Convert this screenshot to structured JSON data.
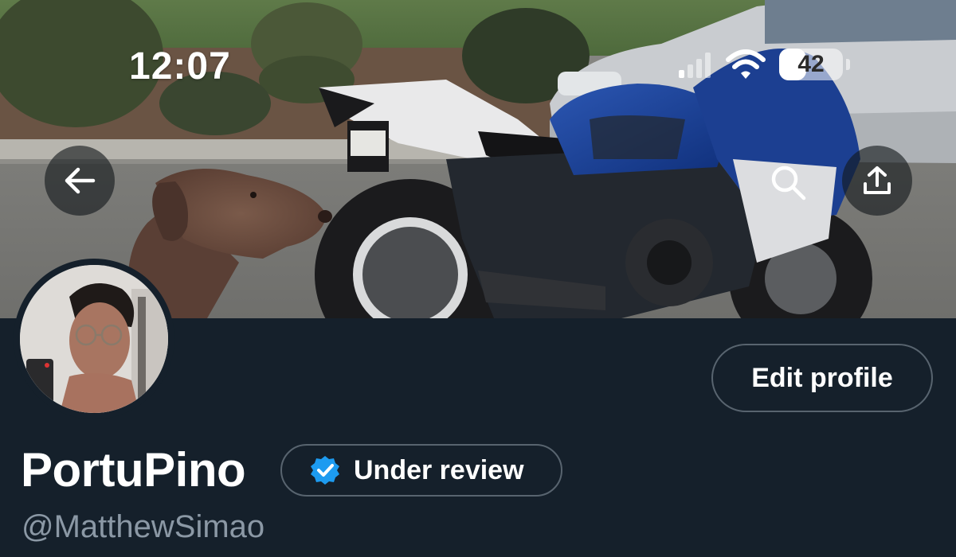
{
  "status_bar": {
    "time": "12:07",
    "signal_icon": "cellular-signal-icon",
    "wifi_icon": "wifi-icon",
    "battery_level": "42",
    "battery_fraction": 0.42
  },
  "header": {
    "back_icon": "arrow-left-icon",
    "search_icon": "search-icon",
    "share_icon": "share-upload-icon"
  },
  "profile": {
    "display_name": "PortuPino",
    "handle": "@MatthewSimao",
    "verification_badge": {
      "icon": "verified-check-icon",
      "label": "Under review",
      "color": "#1d9bf0"
    },
    "edit_profile_label": "Edit profile"
  },
  "colors": {
    "background": "#15202b",
    "text_primary": "#ffffff",
    "text_secondary": "#8b98a5",
    "border": "#58646f",
    "accent": "#1d9bf0"
  }
}
